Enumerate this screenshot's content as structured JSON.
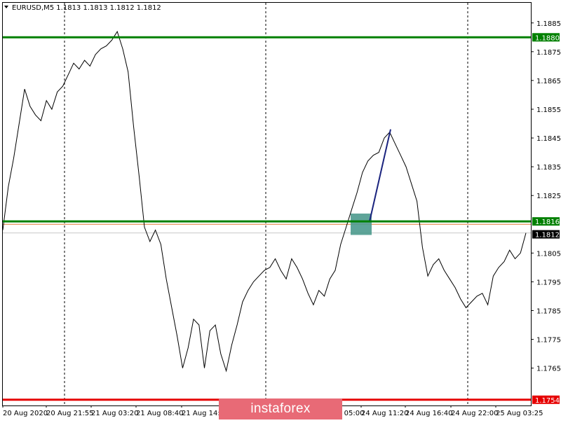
{
  "chart_data": {
    "type": "line",
    "title": "EURUSD,M5  1.1813 1.1813 1.1812 1.1812",
    "symbol": "EURUSD,M5",
    "ohlc": [
      1.1813,
      1.1813,
      1.1812,
      1.1812
    ],
    "ylim": [
      1.1752,
      1.1892
    ],
    "grid": true,
    "x_ticks": [
      "20 Aug 2020",
      "20 Aug 21:55",
      "21 Aug 03:20",
      "21 Aug 08:40",
      "21 Aug 14:00",
      "24 Aug 05:00",
      "24 Aug 11:20",
      "24 Aug 16:40",
      "24 Aug 22:00",
      "25 Aug 03:25"
    ],
    "y_ticks": [
      1.1885,
      1.1875,
      1.1865,
      1.1855,
      1.1845,
      1.1835,
      1.1825,
      1.1805,
      1.1795,
      1.1785,
      1.1775,
      1.1765
    ],
    "series": [
      {
        "values": [
          1.1813,
          1.1828,
          1.1838,
          1.185,
          1.1862,
          1.1856,
          1.1853,
          1.1851,
          1.1858,
          1.1855,
          1.1861,
          1.1863,
          1.1867,
          1.1871,
          1.1869,
          1.1872,
          1.187,
          1.1874,
          1.1876,
          1.1877,
          1.1879,
          1.1882,
          1.1876,
          1.1868,
          1.1849,
          1.1832,
          1.1814,
          1.1809,
          1.1813,
          1.1808,
          1.1796,
          1.1786,
          1.1776,
          1.1765,
          1.1772,
          1.1782,
          1.178,
          1.1765,
          1.1778,
          1.178,
          1.177,
          1.1764,
          1.1773,
          1.178,
          1.1788,
          1.1792,
          1.1795,
          1.1797,
          1.1799,
          1.18,
          1.1803,
          1.1799,
          1.1796,
          1.1803,
          1.18,
          1.1796,
          1.1791,
          1.1787,
          1.1792,
          1.179,
          1.1796,
          1.1799,
          1.1808,
          1.1814,
          1.182,
          1.1826,
          1.1833,
          1.1837,
          1.1839,
          1.184,
          1.1845,
          1.1847,
          1.1843,
          1.1839,
          1.1835,
          1.1829,
          1.1823,
          1.1807,
          1.1797,
          1.1801,
          1.1803,
          1.1799,
          1.1796,
          1.1793,
          1.1789,
          1.1786,
          1.1788,
          1.179,
          1.1791,
          1.1787,
          1.1797,
          1.18,
          1.1802,
          1.1806,
          1.1803,
          1.1805,
          1.1812
        ]
      }
    ],
    "levels": [
      {
        "label": "1.1880",
        "value": 1.188,
        "color": "#008000"
      },
      {
        "label": "1.1816",
        "value": 1.1816,
        "color": "#008000"
      },
      {
        "label": "1.1754",
        "value": 1.1754,
        "color": "#e60000"
      }
    ],
    "current_price": {
      "label": "1.1812",
      "value": 1.1812
    },
    "reference_level": 1.1815,
    "trend_line": {
      "from": 1.1815,
      "to": 1.1848
    },
    "entry_zone": {
      "low": 1.1813,
      "high": 1.1818
    },
    "colors": {
      "buy_level": "#008000",
      "target_level": "#e60000",
      "price_line": "#000000",
      "trend_line": "#1a237e",
      "entry_zone": "#4d9a8e",
      "reference_line": "#e07b39"
    }
  },
  "watermark": {
    "text": "instaforex",
    "color": "#e86a76"
  }
}
